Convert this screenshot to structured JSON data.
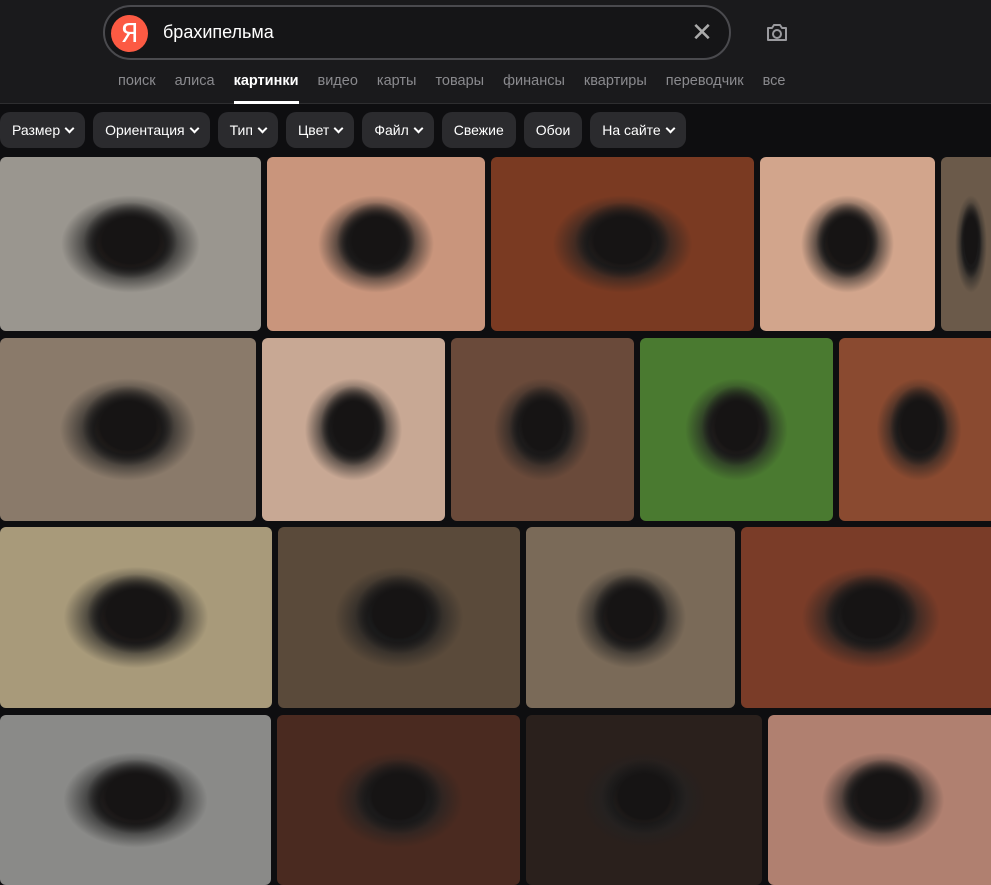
{
  "search": {
    "query": "брахипельма",
    "clear_icon": "close-icon",
    "camera_icon": "camera-icon",
    "logo": "Я"
  },
  "tabs": [
    {
      "label": "поиск"
    },
    {
      "label": "алиса"
    },
    {
      "label": "картинки",
      "active": true
    },
    {
      "label": "видео"
    },
    {
      "label": "карты"
    },
    {
      "label": "товары"
    },
    {
      "label": "финансы"
    },
    {
      "label": "квартиры"
    },
    {
      "label": "переводчик"
    },
    {
      "label": "все"
    }
  ],
  "filters": [
    {
      "label": "Размер",
      "dropdown": true
    },
    {
      "label": "Ориентация",
      "dropdown": true
    },
    {
      "label": "Тип",
      "dropdown": true
    },
    {
      "label": "Цвет",
      "dropdown": true
    },
    {
      "label": "Файл",
      "dropdown": true
    },
    {
      "label": "Свежие",
      "dropdown": false
    },
    {
      "label": "Обои",
      "dropdown": false
    },
    {
      "label": "На сайте",
      "dropdown": true
    }
  ],
  "images": [
    {
      "bg": "#9a968f",
      "accent": "#d8692a"
    },
    {
      "bg": "#c9957c",
      "accent": "#3a3a3a"
    },
    {
      "bg": "#7a3a22",
      "accent": "#e0885a"
    },
    {
      "bg": "#d2a58c",
      "accent": "#c86a2a"
    },
    {
      "bg": "#6b5a4a",
      "accent": "#a8b8c8"
    },
    {
      "bg": "#8a7a6a",
      "accent": "#e09040"
    },
    {
      "bg": "#c8a894",
      "accent": "#5a5a5e"
    },
    {
      "bg": "#6a4a3a",
      "accent": "#9a8a80"
    },
    {
      "bg": "#4a7a30",
      "accent": "#d89a70"
    },
    {
      "bg": "#8a4a30",
      "accent": "#d87040"
    },
    {
      "bg": "#a89a7a",
      "accent": "#d86a30"
    },
    {
      "bg": "#5a4a3a",
      "accent": "#4ab0c0"
    },
    {
      "bg": "#7a6a58",
      "accent": "#e06a30"
    },
    {
      "bg": "#7a3c28",
      "accent": "#b0a8a0"
    },
    {
      "bg": "#8a8a88",
      "accent": "#e09080"
    },
    {
      "bg": "#4a2a20",
      "accent": "#8090a8"
    },
    {
      "bg": "#2a201c",
      "accent": "#e08040"
    },
    {
      "bg": "#b08070",
      "accent": "#c04030"
    }
  ]
}
